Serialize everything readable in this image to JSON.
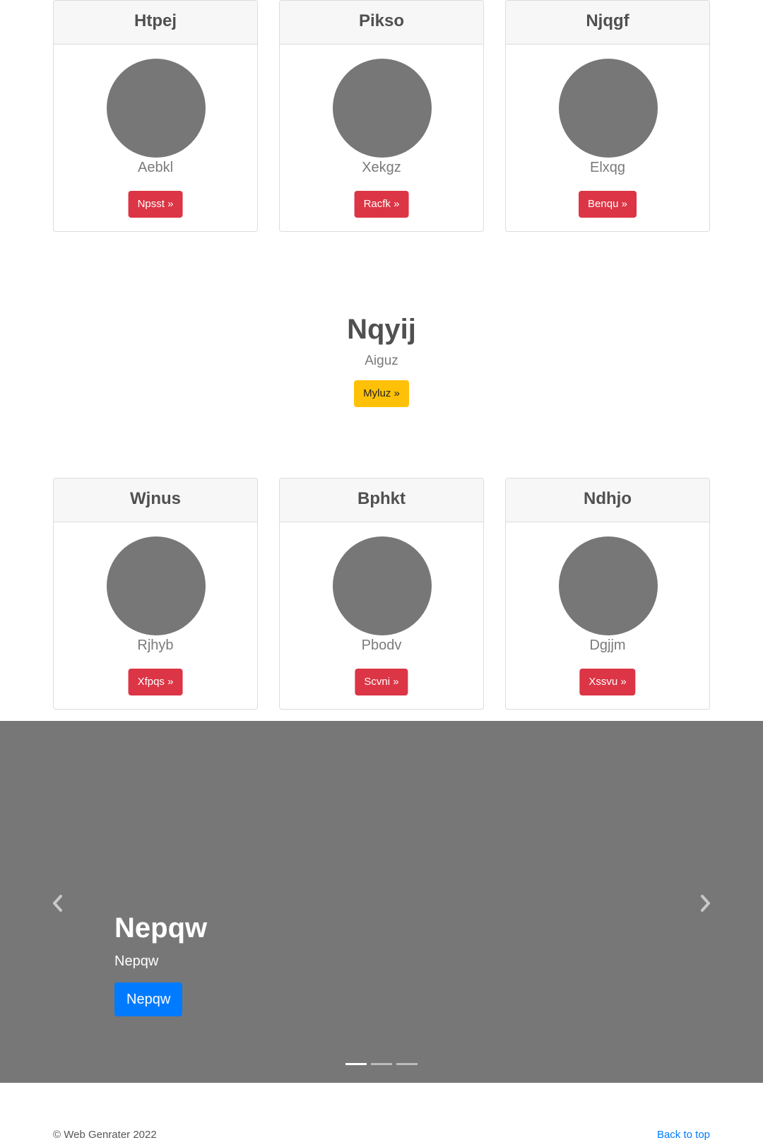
{
  "cards_top": [
    {
      "title": "Htpej",
      "subtitle": "Aebkl",
      "button": "Npsst »"
    },
    {
      "title": "Pikso",
      "subtitle": "Xekgz",
      "button": "Racfk »"
    },
    {
      "title": "Njqgf",
      "subtitle": "Elxqg",
      "button": "Benqu »"
    }
  ],
  "featurette": {
    "title": "Nqyij",
    "subtitle": "Aiguz",
    "button": "Myluz »"
  },
  "cards_bottom": [
    {
      "title": "Wjnus",
      "subtitle": "Rjhyb",
      "button": "Xfpqs »"
    },
    {
      "title": "Bphkt",
      "subtitle": "Pbodv",
      "button": "Scvni »"
    },
    {
      "title": "Ndhjo",
      "subtitle": "Dgjjm",
      "button": "Xssvu »"
    }
  ],
  "carousel": {
    "title": "Nepqw",
    "subtitle": "Nepqw",
    "button": "Nepqw",
    "prev_icon": "chevron-left-icon",
    "next_icon": "chevron-right-icon",
    "slide_count": 3,
    "active_index": 0
  },
  "footer": {
    "copyright": "© Web Genrater 2022",
    "back_to_top": "Back to top"
  },
  "colors": {
    "danger": "#dc3545",
    "warning": "#ffc107",
    "primary": "#007bff",
    "placeholder": "#777777"
  }
}
